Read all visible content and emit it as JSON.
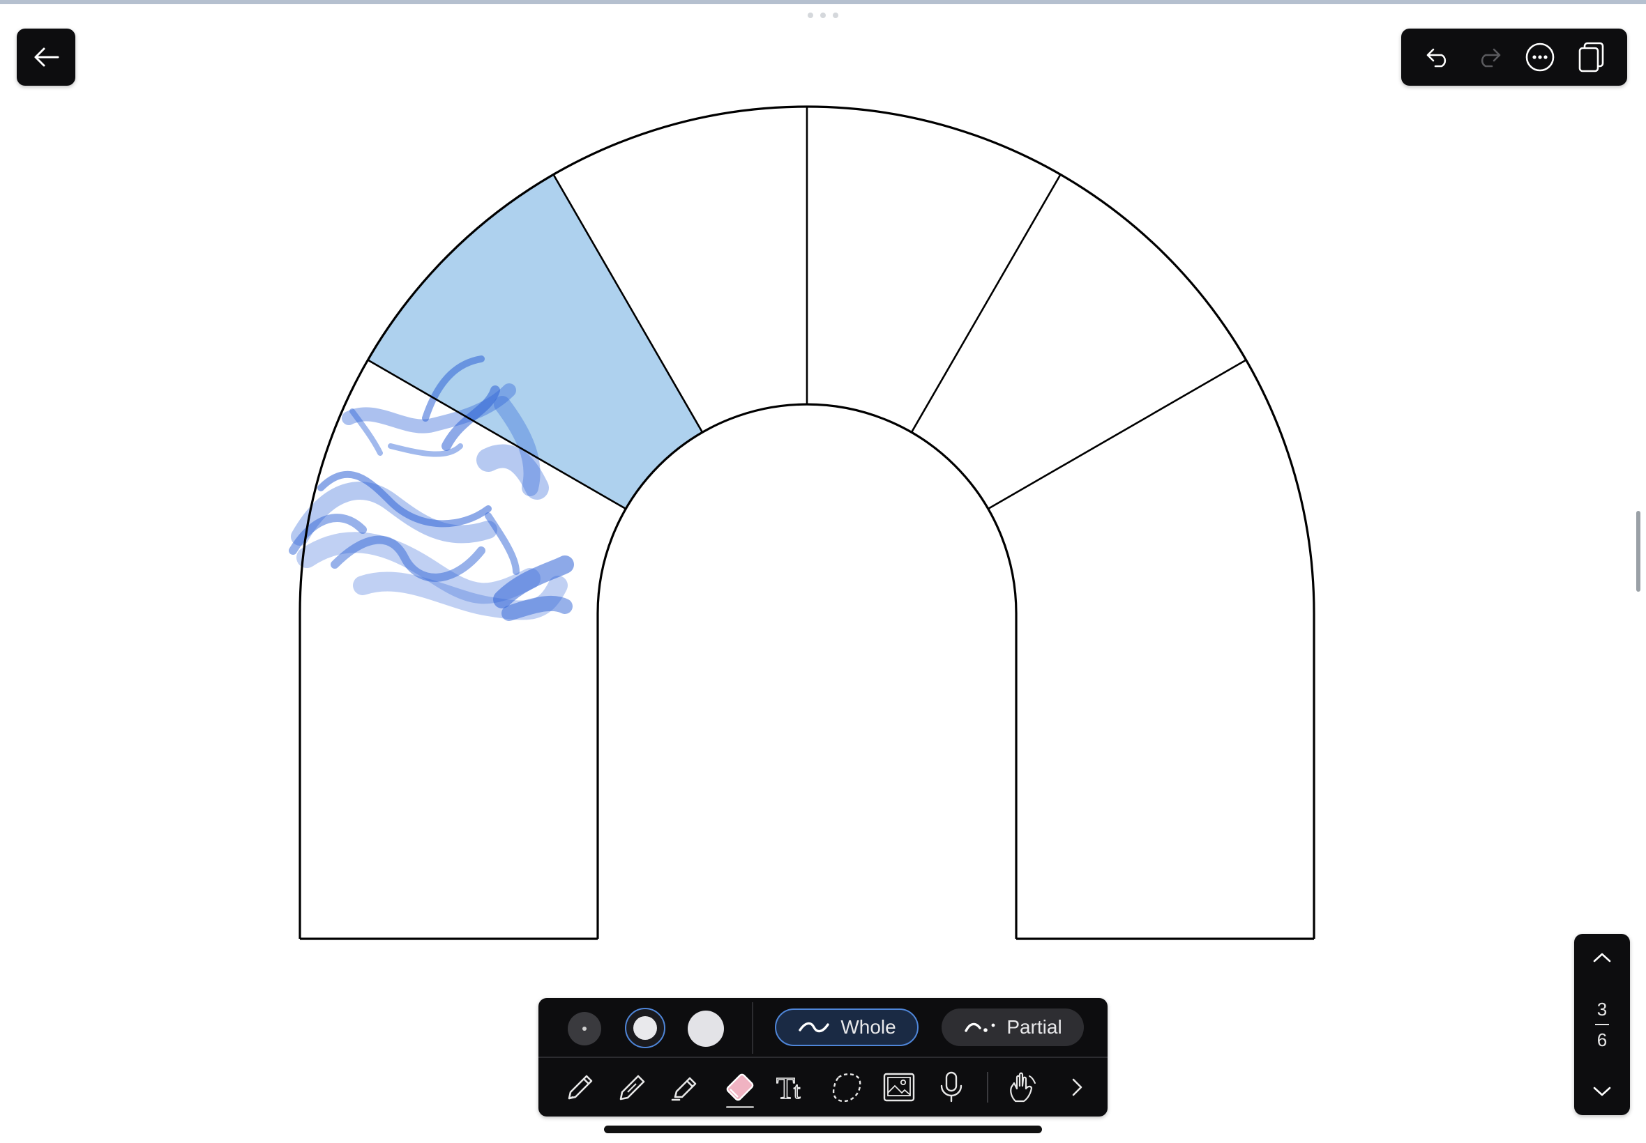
{
  "app": {
    "accent_color": "#4f86d9",
    "highlight_fill": "#aed1ee",
    "ink_color": "#2f63d6"
  },
  "top_bar": {
    "back_icon": "arrow-left-icon",
    "actions": [
      {
        "name": "undo",
        "icon": "undo-icon",
        "enabled": true
      },
      {
        "name": "redo",
        "icon": "redo-icon",
        "enabled": false
      },
      {
        "name": "more",
        "icon": "more-icon"
      },
      {
        "name": "pages",
        "icon": "pages-icon"
      }
    ]
  },
  "page_nav": {
    "current": "3",
    "total": "6",
    "up_icon": "chevron-up-icon",
    "down_icon": "chevron-down-icon"
  },
  "eraser_options": {
    "sizes": [
      "small",
      "medium",
      "large"
    ],
    "selected_size": "medium",
    "modes": {
      "whole": "Whole",
      "partial": "Partial"
    },
    "selected_mode": "Whole"
  },
  "tools": [
    {
      "name": "pen",
      "icon": "pen-icon"
    },
    {
      "name": "pencil",
      "icon": "pencil-icon"
    },
    {
      "name": "highlighter",
      "icon": "highlighter-icon"
    },
    {
      "name": "eraser",
      "icon": "eraser-icon",
      "selected": true
    },
    {
      "name": "text",
      "icon": "text-icon"
    },
    {
      "name": "lasso",
      "icon": "lasso-icon"
    },
    {
      "name": "image",
      "icon": "image-icon"
    },
    {
      "name": "microphone",
      "icon": "microphone-icon"
    },
    {
      "name": "hand",
      "icon": "hand-draw-icon"
    },
    {
      "name": "more-tools",
      "icon": "chevron-right-icon"
    }
  ],
  "diagram": {
    "segments": 6,
    "highlighted_segment": 2
  }
}
